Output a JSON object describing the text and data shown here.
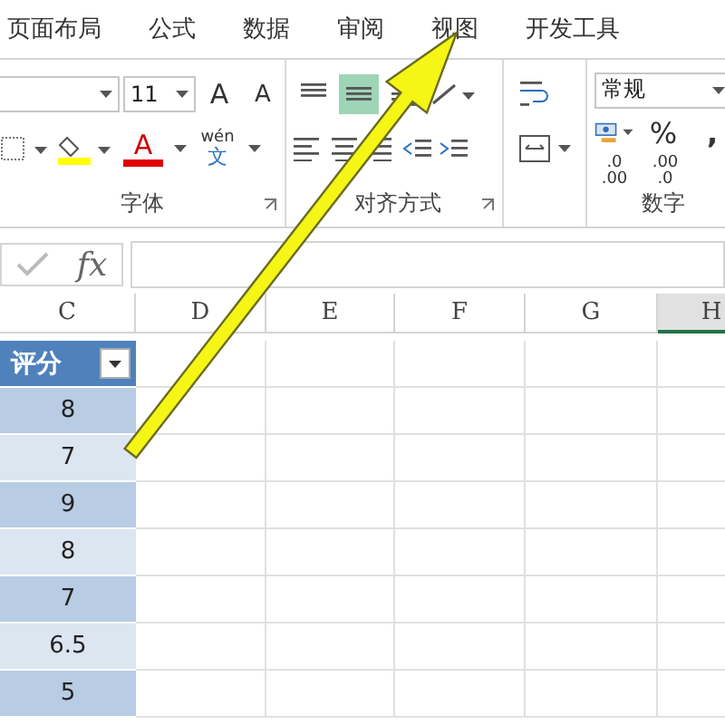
{
  "tabs": [
    {
      "label": "页面布局",
      "selected": false
    },
    {
      "label": "公式",
      "selected": false
    },
    {
      "label": "数据",
      "selected": false
    },
    {
      "label": "审阅",
      "selected": false
    },
    {
      "label": "视图",
      "selected": false
    },
    {
      "label": "开发工具",
      "selected": false
    }
  ],
  "font_group": {
    "font_size": "11",
    "grow_label": "A",
    "shrink_label": "A",
    "font_color_label": "A",
    "phonetic_top": "wén",
    "phonetic_bottom": "文",
    "label": "字体"
  },
  "alignment_group": {
    "vertical_buttons": [
      {
        "kind": "top",
        "selected": false
      },
      {
        "kind": "middle",
        "selected": true
      },
      {
        "kind": "bottom",
        "selected": false
      }
    ],
    "label": "对齐方式"
  },
  "number_group": {
    "format": "常规",
    "percent": "%",
    "comma": ",",
    "decimal_buttons": [
      {
        "top": ".0",
        "bottom": ".00"
      },
      {
        "top": ".00",
        "bottom": ".0"
      }
    ],
    "label": "数字"
  },
  "formula_bar": {
    "fx": "fx"
  },
  "columns": [
    {
      "label": "C",
      "selected": false
    },
    {
      "label": "D",
      "selected": false
    },
    {
      "label": "E",
      "selected": false
    },
    {
      "label": "F",
      "selected": false
    },
    {
      "label": "G",
      "selected": false
    },
    {
      "label": "H",
      "selected": true
    }
  ],
  "table": {
    "header": "评分",
    "values": [
      "8",
      "7",
      "9",
      "8",
      "7",
      "6.5",
      "5"
    ]
  }
}
